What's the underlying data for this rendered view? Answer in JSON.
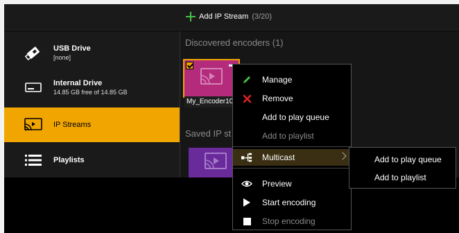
{
  "toolbar": {
    "add_label": "Add IP Stream",
    "add_count": "(3/20)",
    "accent_color": "#46c346"
  },
  "sidebar": {
    "items": [
      {
        "title": "USB Drive",
        "subtitle": "[none]",
        "icon": "usb-drive-icon"
      },
      {
        "title": "Internal Drive",
        "subtitle": "14.85 GB free of 14.85 GB",
        "icon": "hard-drive-icon"
      },
      {
        "title": "IP Streams",
        "subtitle": "",
        "icon": "ip-stream-icon",
        "active": true
      },
      {
        "title": "Playlists",
        "subtitle": "",
        "icon": "list-icon"
      }
    ],
    "active_color": "#f0a500"
  },
  "main": {
    "discovered_title": "Discovered encoders",
    "discovered_count": "(1)",
    "encoder": {
      "label": "My_Encoder10",
      "more": "•••",
      "color": "#b42b7c"
    },
    "saved_title": "Saved IP st",
    "saved_color": "#6a2b9a"
  },
  "context_menu": {
    "items": [
      {
        "label": "Manage",
        "icon": "pencil-icon"
      },
      {
        "label": "Remove",
        "icon": "close-icon"
      },
      {
        "label": "Add to play queue",
        "icon": ""
      },
      {
        "label": "Add to playlist",
        "icon": "",
        "disabled": true
      },
      {
        "label": "Multicast",
        "icon": "multicast-icon",
        "has_submenu": true
      },
      {
        "label": "Preview",
        "icon": "eye-icon"
      },
      {
        "label": "Start encoding",
        "icon": "play-icon"
      },
      {
        "label": "Stop encoding",
        "icon": "stop-icon",
        "disabled": true
      }
    ]
  },
  "submenu": {
    "items": [
      {
        "label": "Add to play queue"
      },
      {
        "label": "Add to playlist"
      }
    ]
  }
}
